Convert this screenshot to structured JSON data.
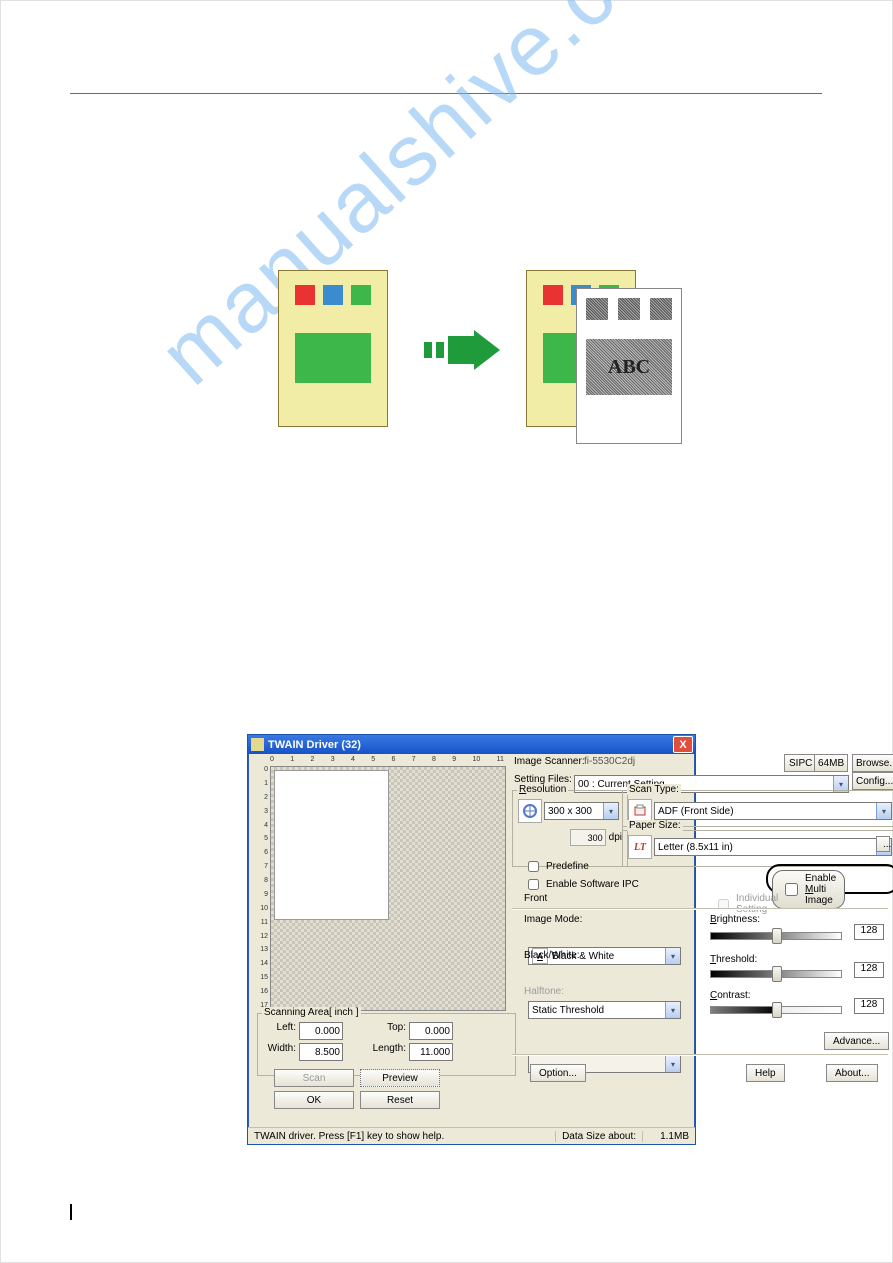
{
  "diagram": {
    "abc_label": "ABC"
  },
  "twain": {
    "title": "TWAIN Driver (32)",
    "close": "X",
    "scanner_label": "Image Scanner:",
    "scanner_value": "fi-5530C2dj",
    "sipc": "SIPC",
    "mem": "64MB",
    "browse": "Browse...",
    "setting_files_label": "Setting Files:",
    "setting_files_value": "00 : Current Setting",
    "config": "Config...",
    "resolution_label": "Resolution",
    "resolution_value": "300 x 300",
    "resolution_custom": "300",
    "dpi": "dpi",
    "scan_type_label": "Scan Type:",
    "scan_type_value": "ADF (Front Side)",
    "paper_size_label": "Paper Size:",
    "paper_size_value": "Letter (8.5x11 in)",
    "paper_size_icon": "LT",
    "dots": "...",
    "predefine": "Predefine",
    "enable_sw_ipc": "Enable Software IPC",
    "enable_multi": "Enable Multi Image",
    "front": "Front",
    "individual": "Individual Setting",
    "image_mode_label": "Image Mode:",
    "image_mode_value": "Black & White",
    "bw_label": "Black/White:",
    "bw_value": "Static Threshold",
    "halftone_label": "Halftone:",
    "brightness_label": "Brightness:",
    "threshold_label": "Threshold:",
    "contrast_label": "Contrast:",
    "brightness_val": "128",
    "threshold_val": "128",
    "contrast_val": "128",
    "advance": "Advance...",
    "option": "Option...",
    "help": "Help",
    "about": "About...",
    "scanning_area_label": "Scanning Area[ inch ]",
    "left": "Left:",
    "top": "Top:",
    "width": "Width:",
    "length": "Length:",
    "left_v": "0.000",
    "top_v": "0.000",
    "width_v": "8.500",
    "length_v": "11.000",
    "scan_btn": "Scan",
    "preview_btn": "Preview",
    "ok_btn": "OK",
    "reset_btn": "Reset",
    "status": "TWAIN driver. Press [F1] key to show help.",
    "data_size_label": "Data Size about:",
    "data_size": "1.1MB",
    "ruler_h": [
      "0",
      "1",
      "2",
      "3",
      "4",
      "5",
      "6",
      "7",
      "8",
      "9",
      "10",
      "11"
    ],
    "ruler_v": [
      "0",
      "1",
      "2",
      "3",
      "4",
      "5",
      "6",
      "7",
      "8",
      "9",
      "10",
      "11",
      "12",
      "13",
      "14",
      "15",
      "16",
      "17"
    ]
  }
}
